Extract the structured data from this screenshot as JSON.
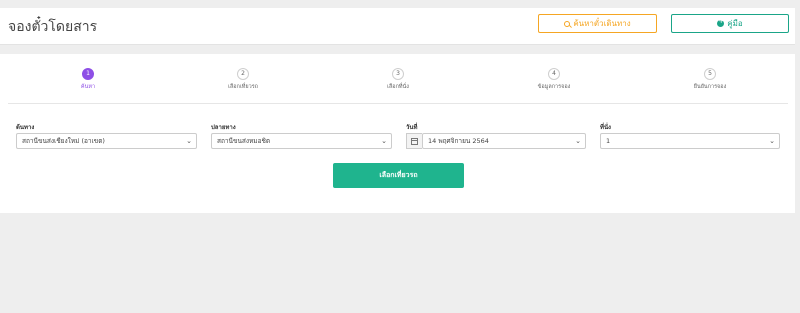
{
  "header": {
    "title": "จองตั๋วโดยสาร",
    "search_button": "ค้นหาตั๋วเดินทาง",
    "manual_button": "คู่มือ"
  },
  "steps": [
    {
      "num": "1",
      "label": "ค้นหา",
      "active": true
    },
    {
      "num": "2",
      "label": "เลือกเที่ยวรถ",
      "active": false
    },
    {
      "num": "3",
      "label": "เลือกที่นั่ง",
      "active": false
    },
    {
      "num": "4",
      "label": "ข้อมูลการจอง",
      "active": false
    },
    {
      "num": "5",
      "label": "ยืนยันการจอง",
      "active": false
    }
  ],
  "form": {
    "origin_label": "ต้นทาง",
    "origin_value": "สถานีขนส่งเชียงใหม่ (อาเขต)",
    "destination_label": "ปลายทาง",
    "destination_value": "สถานีขนส่งหมอชิต",
    "date_label": "วันที่",
    "date_value": "14 พฤศจิกายน 2564",
    "seats_label": "ที่นั่ง",
    "seats_value": "1",
    "submit_label": "เลือกเที่ยวรถ"
  },
  "colors": {
    "accent_active_step": "#8e4fe6",
    "primary_button": "#1fb48e",
    "search_button": "#f5a623"
  }
}
